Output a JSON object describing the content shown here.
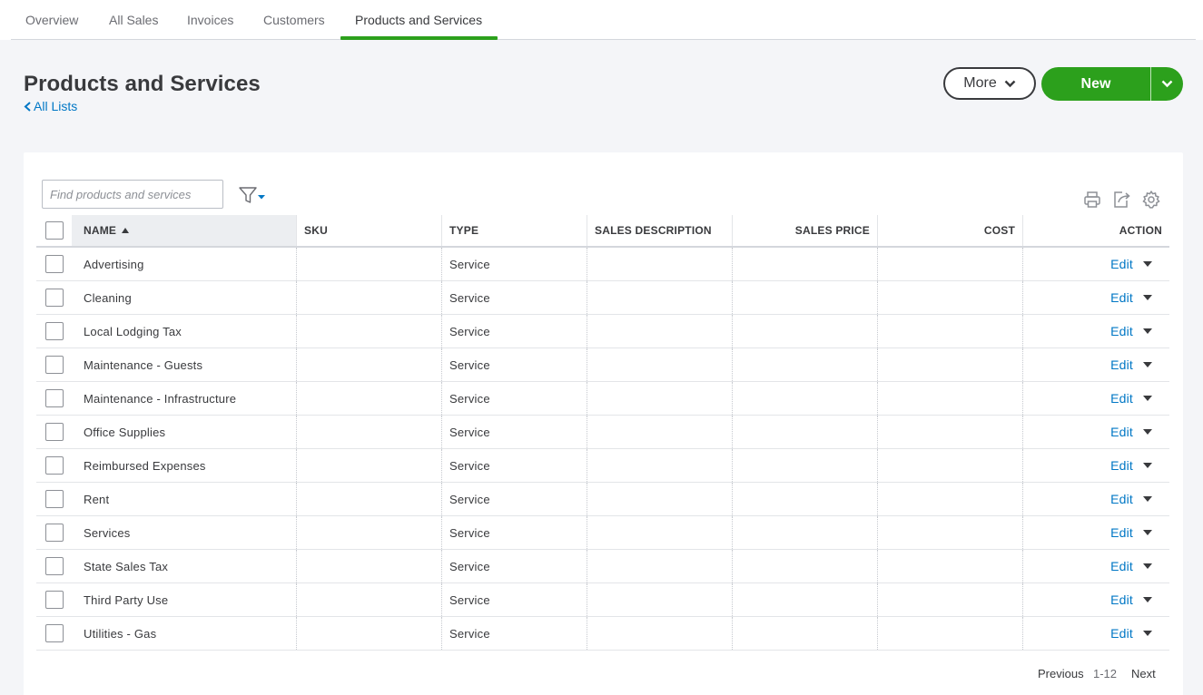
{
  "tabs": [
    {
      "label": "Overview"
    },
    {
      "label": "All Sales"
    },
    {
      "label": "Invoices"
    },
    {
      "label": "Customers"
    },
    {
      "label": "Products and Services",
      "active": true
    }
  ],
  "header": {
    "title": "Products and Services",
    "back_link": "All Lists",
    "more_label": "More",
    "new_label": "New"
  },
  "search": {
    "placeholder": "Find products and services"
  },
  "table": {
    "columns": [
      "NAME",
      "SKU",
      "TYPE",
      "SALES DESCRIPTION",
      "SALES PRICE",
      "COST",
      "ACTION"
    ],
    "sort_column": "NAME",
    "rows": [
      {
        "name": "Advertising",
        "sku": "",
        "type": "Service",
        "desc": "",
        "price": "",
        "cost": "",
        "action": "Edit"
      },
      {
        "name": "Cleaning",
        "sku": "",
        "type": "Service",
        "desc": "",
        "price": "",
        "cost": "",
        "action": "Edit"
      },
      {
        "name": "Local Lodging Tax",
        "sku": "",
        "type": "Service",
        "desc": "",
        "price": "",
        "cost": "",
        "action": "Edit"
      },
      {
        "name": "Maintenance - Guests",
        "sku": "",
        "type": "Service",
        "desc": "",
        "price": "",
        "cost": "",
        "action": "Edit"
      },
      {
        "name": "Maintenance - Infrastructure",
        "sku": "",
        "type": "Service",
        "desc": "",
        "price": "",
        "cost": "",
        "action": "Edit"
      },
      {
        "name": "Office Supplies",
        "sku": "",
        "type": "Service",
        "desc": "",
        "price": "",
        "cost": "",
        "action": "Edit"
      },
      {
        "name": "Reimbursed Expenses",
        "sku": "",
        "type": "Service",
        "desc": "",
        "price": "",
        "cost": "",
        "action": "Edit"
      },
      {
        "name": "Rent",
        "sku": "",
        "type": "Service",
        "desc": "",
        "price": "",
        "cost": "",
        "action": "Edit"
      },
      {
        "name": "Services",
        "sku": "",
        "type": "Service",
        "desc": "",
        "price": "",
        "cost": "",
        "action": "Edit"
      },
      {
        "name": "State Sales Tax",
        "sku": "",
        "type": "Service",
        "desc": "",
        "price": "",
        "cost": "",
        "action": "Edit"
      },
      {
        "name": "Third Party Use",
        "sku": "",
        "type": "Service",
        "desc": "",
        "price": "",
        "cost": "",
        "action": "Edit"
      },
      {
        "name": "Utilities - Gas",
        "sku": "",
        "type": "Service",
        "desc": "",
        "price": "",
        "cost": "",
        "action": "Edit"
      }
    ]
  },
  "pagination": {
    "previous": "Previous",
    "range": "1-12",
    "next": "Next"
  },
  "toolbar_icons": [
    "print-icon",
    "export-icon",
    "settings-gear-icon"
  ],
  "colors": {
    "accent_green": "#2ca01c",
    "link_blue": "#0077c5",
    "text": "#393a3d"
  }
}
